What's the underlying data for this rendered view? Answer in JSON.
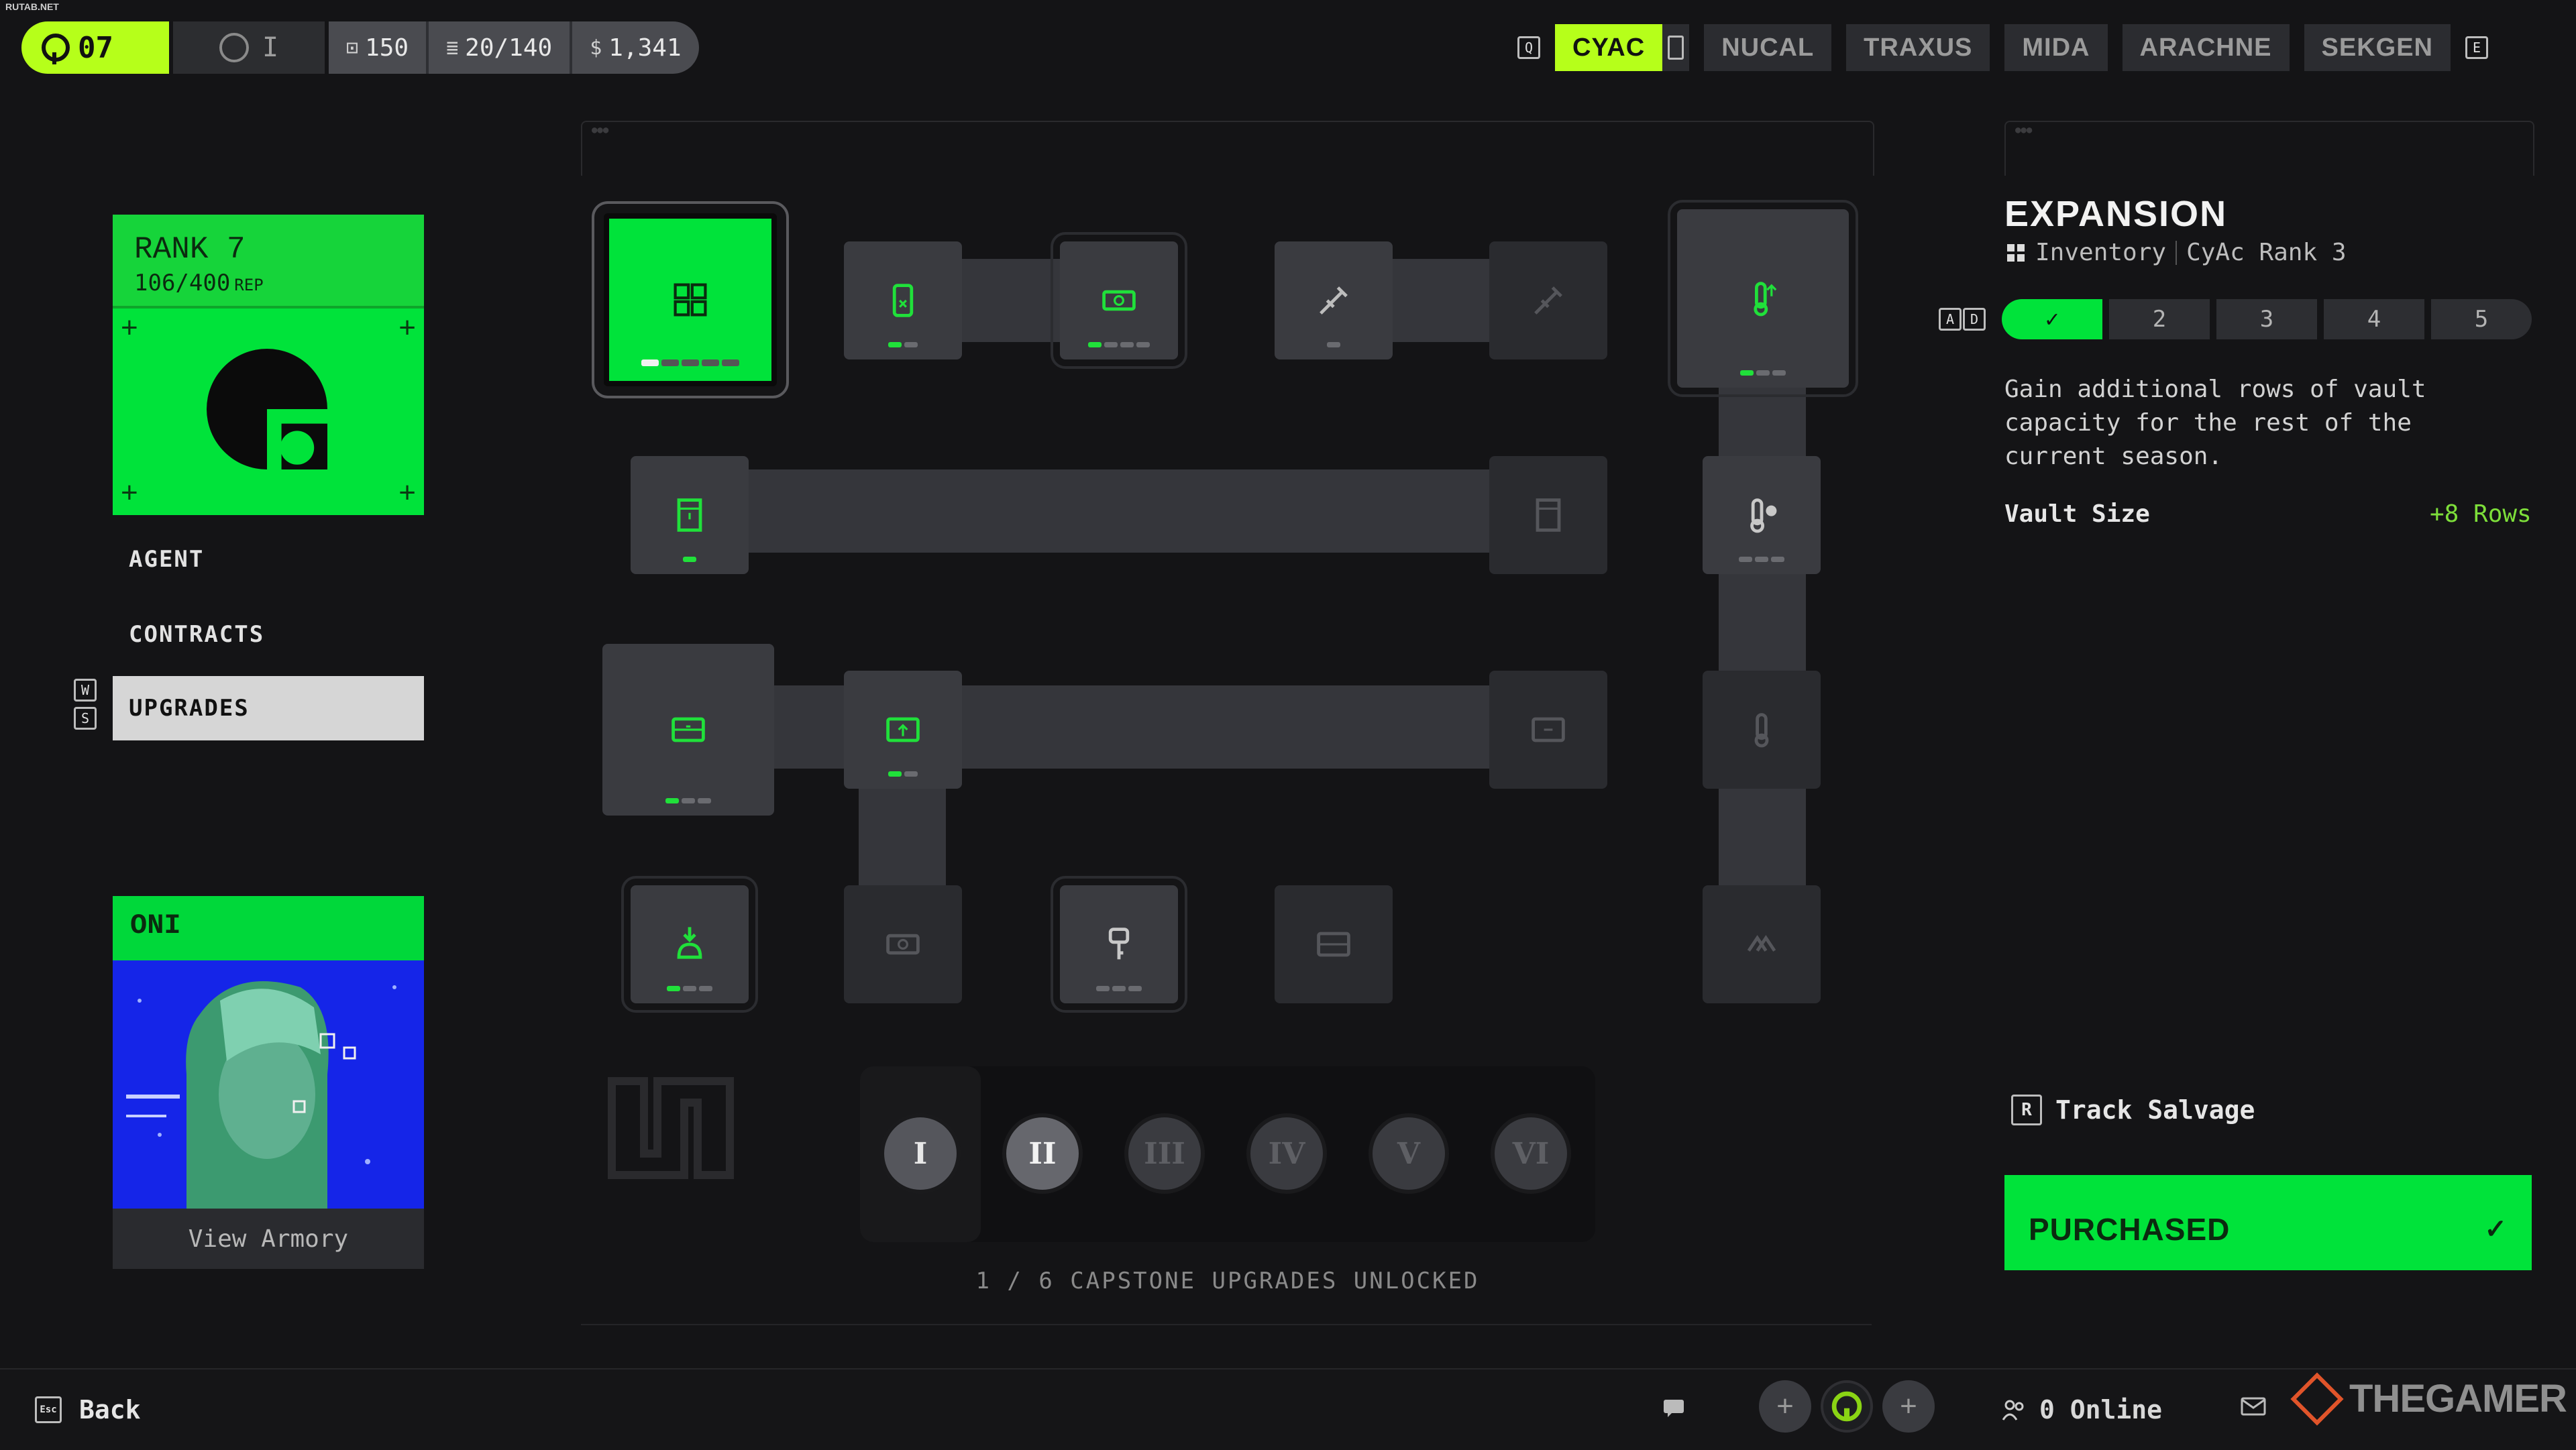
{
  "watermark_top": "RUTAB.NET",
  "topbar": {
    "level": "07",
    "prestige": "I",
    "stats": [
      {
        "icon": "crate-icon",
        "glyph": "⊡",
        "value": "150"
      },
      {
        "icon": "backpack-icon",
        "glyph": "≣",
        "value": "20/140"
      },
      {
        "icon": "credits-icon",
        "glyph": "$",
        "value": "1,341"
      }
    ],
    "key_prev": "Q",
    "key_next": "E",
    "factions": [
      "CYAC",
      "NUCAL",
      "TRAXUS",
      "MIDA",
      "ARACHNE",
      "SEKGEN"
    ],
    "active_faction": "CYAC"
  },
  "rank": {
    "title": "RANK 7",
    "rep": "106/400",
    "rep_unit": "REP"
  },
  "nav": {
    "items": [
      "AGENT",
      "CONTRACTS",
      "UPGRADES"
    ],
    "active": "UPGRADES",
    "key_up": "W",
    "key_down": "S"
  },
  "character": {
    "name": "ONI",
    "action": "View Armory"
  },
  "capstones": {
    "labels": [
      "I",
      "II",
      "III",
      "IV",
      "V",
      "VI"
    ],
    "unlocked": 1,
    "summary": "1 / 6 CAPSTONE UPGRADES UNLOCKED"
  },
  "detail": {
    "title": "EXPANSION",
    "category": "Inventory",
    "requirement": "CyAc Rank 3",
    "key_a": "A",
    "key_d": "D",
    "tiers": [
      "✓",
      "2",
      "3",
      "4",
      "5"
    ],
    "tiers_completed": 1,
    "description": "Gain additional rows of vault capacity for the rest of the current season.",
    "stat_label": "Vault Size",
    "stat_value": "+8 Rows",
    "track_key": "R",
    "track_label": "Track Salvage",
    "purchase_label": "PURCHASED",
    "purchase_check": "✓"
  },
  "bottom": {
    "back_key": "Esc",
    "back_label": "Back",
    "online": "0 Online",
    "brand": "THEGAMER"
  },
  "colors": {
    "accent_green": "#00e33a",
    "lime": "#b6ff1a",
    "panel": "#3a3b40",
    "background": "#141416"
  }
}
